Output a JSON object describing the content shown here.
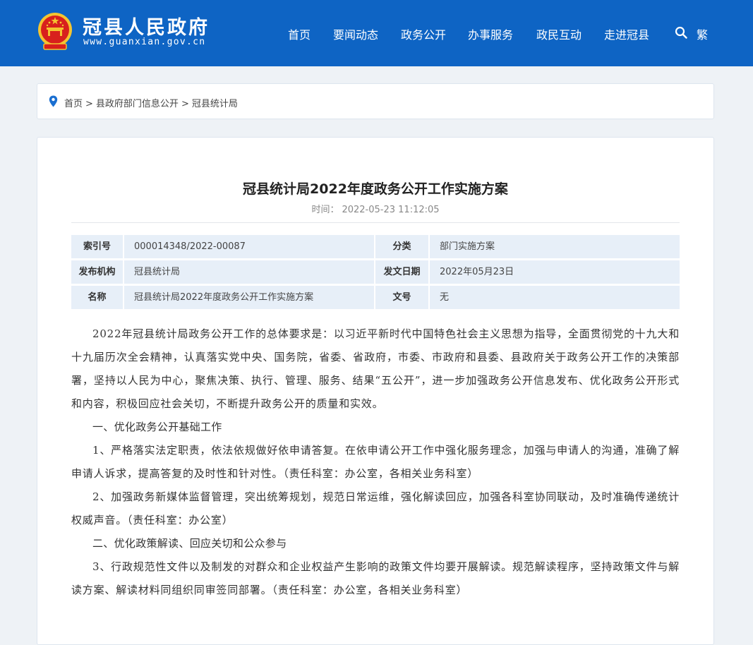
{
  "header": {
    "site_title": "冠县人民政府",
    "site_url": "www.guanxian.gov.cn",
    "nav": [
      "首页",
      "要闻动态",
      "政务公开",
      "办事服务",
      "政民互动",
      "走进冠县"
    ],
    "search_icon": "search-icon",
    "trad_toggle": "繁",
    "bg_color": "#0e64c4"
  },
  "breadcrumb": {
    "icon": "location-pin-icon",
    "items": [
      "首页",
      "县政府部门信息公开",
      "冠县统计局"
    ],
    "separator": ">"
  },
  "article": {
    "title": "冠县统计局2022年度政务公开工作实施方案",
    "time_label": "时间：",
    "time_value": "2022-05-23 11:12:05",
    "meta": [
      {
        "label1": "索引号",
        "value1": "000014348/2022-00087",
        "label2": "分类",
        "value2": "部门实施方案"
      },
      {
        "label1": "发布机构",
        "value1": "冠县统计局",
        "label2": "发文日期",
        "value2": "2022年05月23日"
      },
      {
        "label1": "名称",
        "value1": "冠县统计局2022年度政务公开工作实施方案",
        "label2": "文号",
        "value2": "无"
      }
    ],
    "paragraphs": [
      "2022年冠县统计局政务公开工作的总体要求是：以习近平新时代中国特色社会主义思想为指导，全面贯彻党的十九大和十九届历次全会精神，认真落实党中央、国务院，省委、省政府，市委、市政府和县委、县政府关于政务公开工作的决策部署，坚持以人民为中心，聚焦决策、执行、管理、服务、结果“五公开”，进一步加强政务公开信息发布、优化政务公开形式和内容，积极回应社会关切，不断提升政务公开的质量和实效。",
      "一、优化政务公开基础工作",
      "1、严格落实法定职责，依法依规做好依申请答复。在依申请公开工作中强化服务理念，加强与申请人的沟通，准确了解申请人诉求，提高答复的及时性和针对性。（责任科室：办公室，各相关业务科室）",
      "2、加强政务新媒体监督管理，突出统筹规划，规范日常运维，强化解读回应，加强各科室协同联动，及时准确传递统计权威声音。（责任科室：办公室）",
      "二、优化政策解读、回应关切和公众参与",
      "3、行政规范性文件以及制发的对群众和企业权益产生影响的政策文件均要开展解读。规范解读程序，坚持政策文件与解读方案、解读材料同组织同审签同部署。（责任科室：办公室，各相关业务科室）"
    ]
  }
}
